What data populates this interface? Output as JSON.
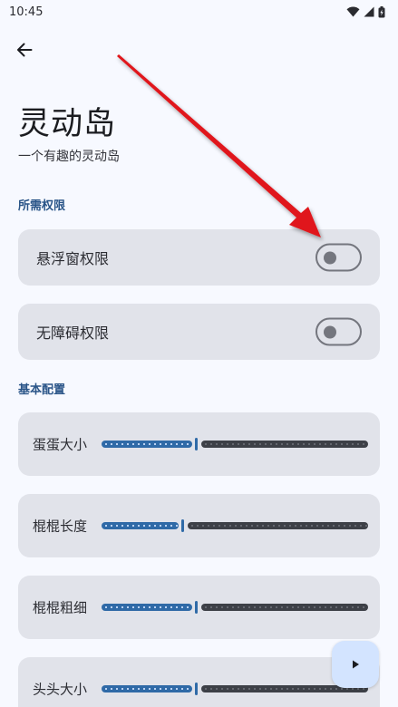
{
  "status_bar": {
    "time": "10:45"
  },
  "header": {
    "title": "灵动岛",
    "subtitle": "一个有趣的灵动岛"
  },
  "sections": {
    "permissions": {
      "title": "所需权限",
      "items": [
        {
          "label": "悬浮窗权限",
          "enabled": false
        },
        {
          "label": "无障碍权限",
          "enabled": false
        }
      ]
    },
    "basic": {
      "title": "基本配置",
      "sliders": [
        {
          "label": "蛋蛋大小",
          "value": 0.35
        },
        {
          "label": "棍棍长度",
          "value": 0.3
        },
        {
          "label": "棍棍粗细",
          "value": 0.35
        },
        {
          "label": "头头大小",
          "value": 0.35
        }
      ]
    }
  },
  "colors": {
    "accent": "#2f6aa7",
    "section_header": "#2a5588",
    "card": "#e1e3ea",
    "background": "#f7f9ff",
    "fab": "#d3e4ff",
    "annotation_arrow": "#e0141a"
  },
  "icons": {
    "back": "arrow-left-icon",
    "fab": "play-icon",
    "status": [
      "wifi-icon",
      "signal-icon",
      "battery-icon"
    ]
  }
}
